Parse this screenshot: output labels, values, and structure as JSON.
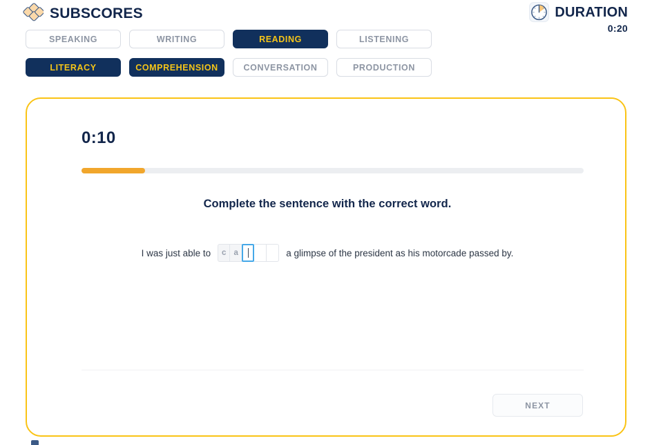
{
  "header": {
    "brand_title": "SUBSCORES",
    "brand_logo_icon": "diamond-cluster-icon",
    "duration_title": "DURATION",
    "duration_icon": "clock-timer-icon",
    "duration_value": "0:20"
  },
  "tabs": {
    "row1": [
      {
        "label": "SPEAKING",
        "active": false
      },
      {
        "label": "WRITING",
        "active": false
      },
      {
        "label": "READING",
        "active": true
      },
      {
        "label": "LISTENING",
        "active": false
      }
    ],
    "row2": [
      {
        "label": "LITERACY",
        "active": true
      },
      {
        "label": "COMPREHENSION",
        "active": true
      },
      {
        "label": "CONVERSATION",
        "active": false
      },
      {
        "label": "PRODUCTION",
        "active": false
      }
    ]
  },
  "card": {
    "timer": "0:10",
    "progress_percent": 12.7,
    "prompt": "Complete the sentence with the correct word.",
    "sentence_prefix": "I was just able to",
    "sentence_suffix": "a glimpse of the president as his motorcade passed by.",
    "letter_cells": [
      {
        "value": "c",
        "state": "filled"
      },
      {
        "value": "a",
        "state": "filled"
      },
      {
        "value": "",
        "state": "active"
      },
      {
        "value": "",
        "state": "empty"
      },
      {
        "value": "",
        "state": "empty"
      }
    ],
    "next_label": "NEXT"
  },
  "colors": {
    "navy": "#11305c",
    "accent_yellow": "#f5c518",
    "card_border": "#fac314",
    "progress_fill": "#f1a62c",
    "active_cell_border": "#45a8e8",
    "muted_text": "#8d95a3"
  }
}
